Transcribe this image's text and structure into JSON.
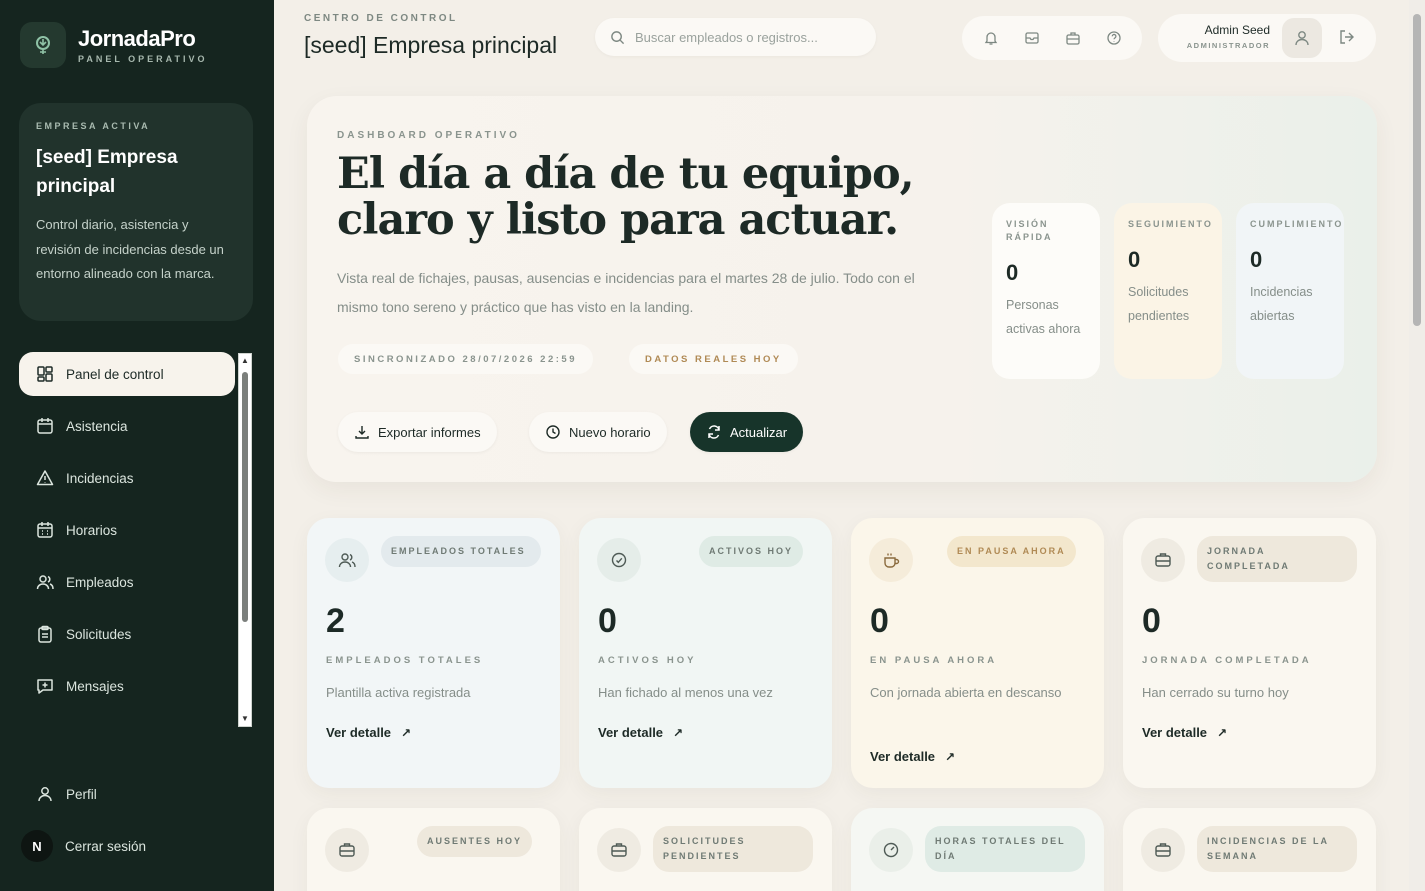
{
  "brand": {
    "name": "JornadaPro",
    "subtitle": "PANEL OPERATIVO"
  },
  "company_card": {
    "kicker": "EMPRESA ACTIVA",
    "name": "[seed] Empresa principal",
    "description": "Control diario, asistencia y revisión de incidencias desde un entorno alineado con la marca."
  },
  "nav": {
    "items": [
      {
        "label": "Panel de control",
        "icon": "dashboard-icon",
        "active": true
      },
      {
        "label": "Asistencia",
        "icon": "calendar-icon"
      },
      {
        "label": "Incidencias",
        "icon": "warning-icon"
      },
      {
        "label": "Horarios",
        "icon": "calendar-grid-icon"
      },
      {
        "label": "Empleados",
        "icon": "users-icon"
      },
      {
        "label": "Solicitudes",
        "icon": "clipboard-icon"
      },
      {
        "label": "Mensajes",
        "icon": "message-plus-icon"
      }
    ],
    "profile": "Perfil",
    "logout": "Cerrar sesión",
    "avatar_letter": "N"
  },
  "header": {
    "kicker": "CENTRO DE CONTROL",
    "title": "[seed] Empresa principal",
    "search_placeholder": "Buscar empleados o registros...",
    "user_name": "Admin Seed",
    "user_role": "ADMINISTRADOR"
  },
  "hero": {
    "kicker": "DASHBOARD OPERATIVO",
    "title": "El día a día de tu equipo, claro y listo para actuar.",
    "description": "Vista real de fichajes, pausas, ausencias e incidencias para el martes 28 de julio. Todo con el mismo tono sereno y práctico que has visto en la landing.",
    "chip_sync": "SINCRONIZADO 28/07/2026 22:59",
    "chip_real": "DATOS REALES HOY",
    "btn_export": "Exportar informes",
    "btn_schedule": "Nuevo horario",
    "btn_refresh": "Actualizar",
    "mini": [
      {
        "kicker": "VISIÓN RÁPIDA",
        "value": "0",
        "label": "Personas activas ahora"
      },
      {
        "kicker": "SEGUIMIENTO",
        "value": "0",
        "label": "Solicitudes pendientes"
      },
      {
        "kicker": "CUMPLIMIENTO",
        "value": "0",
        "label": "Incidencias abiertas"
      }
    ]
  },
  "cards": [
    {
      "badge": "EMPLEADOS TOTALES",
      "value": "2",
      "label": "EMPLEADOS TOTALES",
      "desc": "Plantilla activa registrada",
      "link": "Ver detalle"
    },
    {
      "badge": "ACTIVOS HOY",
      "value": "0",
      "label": "ACTIVOS HOY",
      "desc": "Han fichado al menos una vez",
      "link": "Ver detalle"
    },
    {
      "badge": "EN PAUSA AHORA",
      "value": "0",
      "label": "EN PAUSA AHORA",
      "desc": "Con jornada abierta en descanso",
      "link": "Ver detalle"
    },
    {
      "badge": "JORNADA COMPLETADA",
      "value": "0",
      "label": "JORNADA COMPLETADA",
      "desc": "Han cerrado su turno hoy",
      "link": "Ver detalle"
    },
    {
      "badge": "AUSENTES HOY"
    },
    {
      "badge": "SOLICITUDES PENDIENTES"
    },
    {
      "badge": "HORAS TOTALES DEL DÍA"
    },
    {
      "badge": "INCIDENCIAS DE LA SEMANA"
    }
  ],
  "colors": {
    "sidebar": "#15251f",
    "accent": "#17342a",
    "background": "#f3efe8"
  }
}
